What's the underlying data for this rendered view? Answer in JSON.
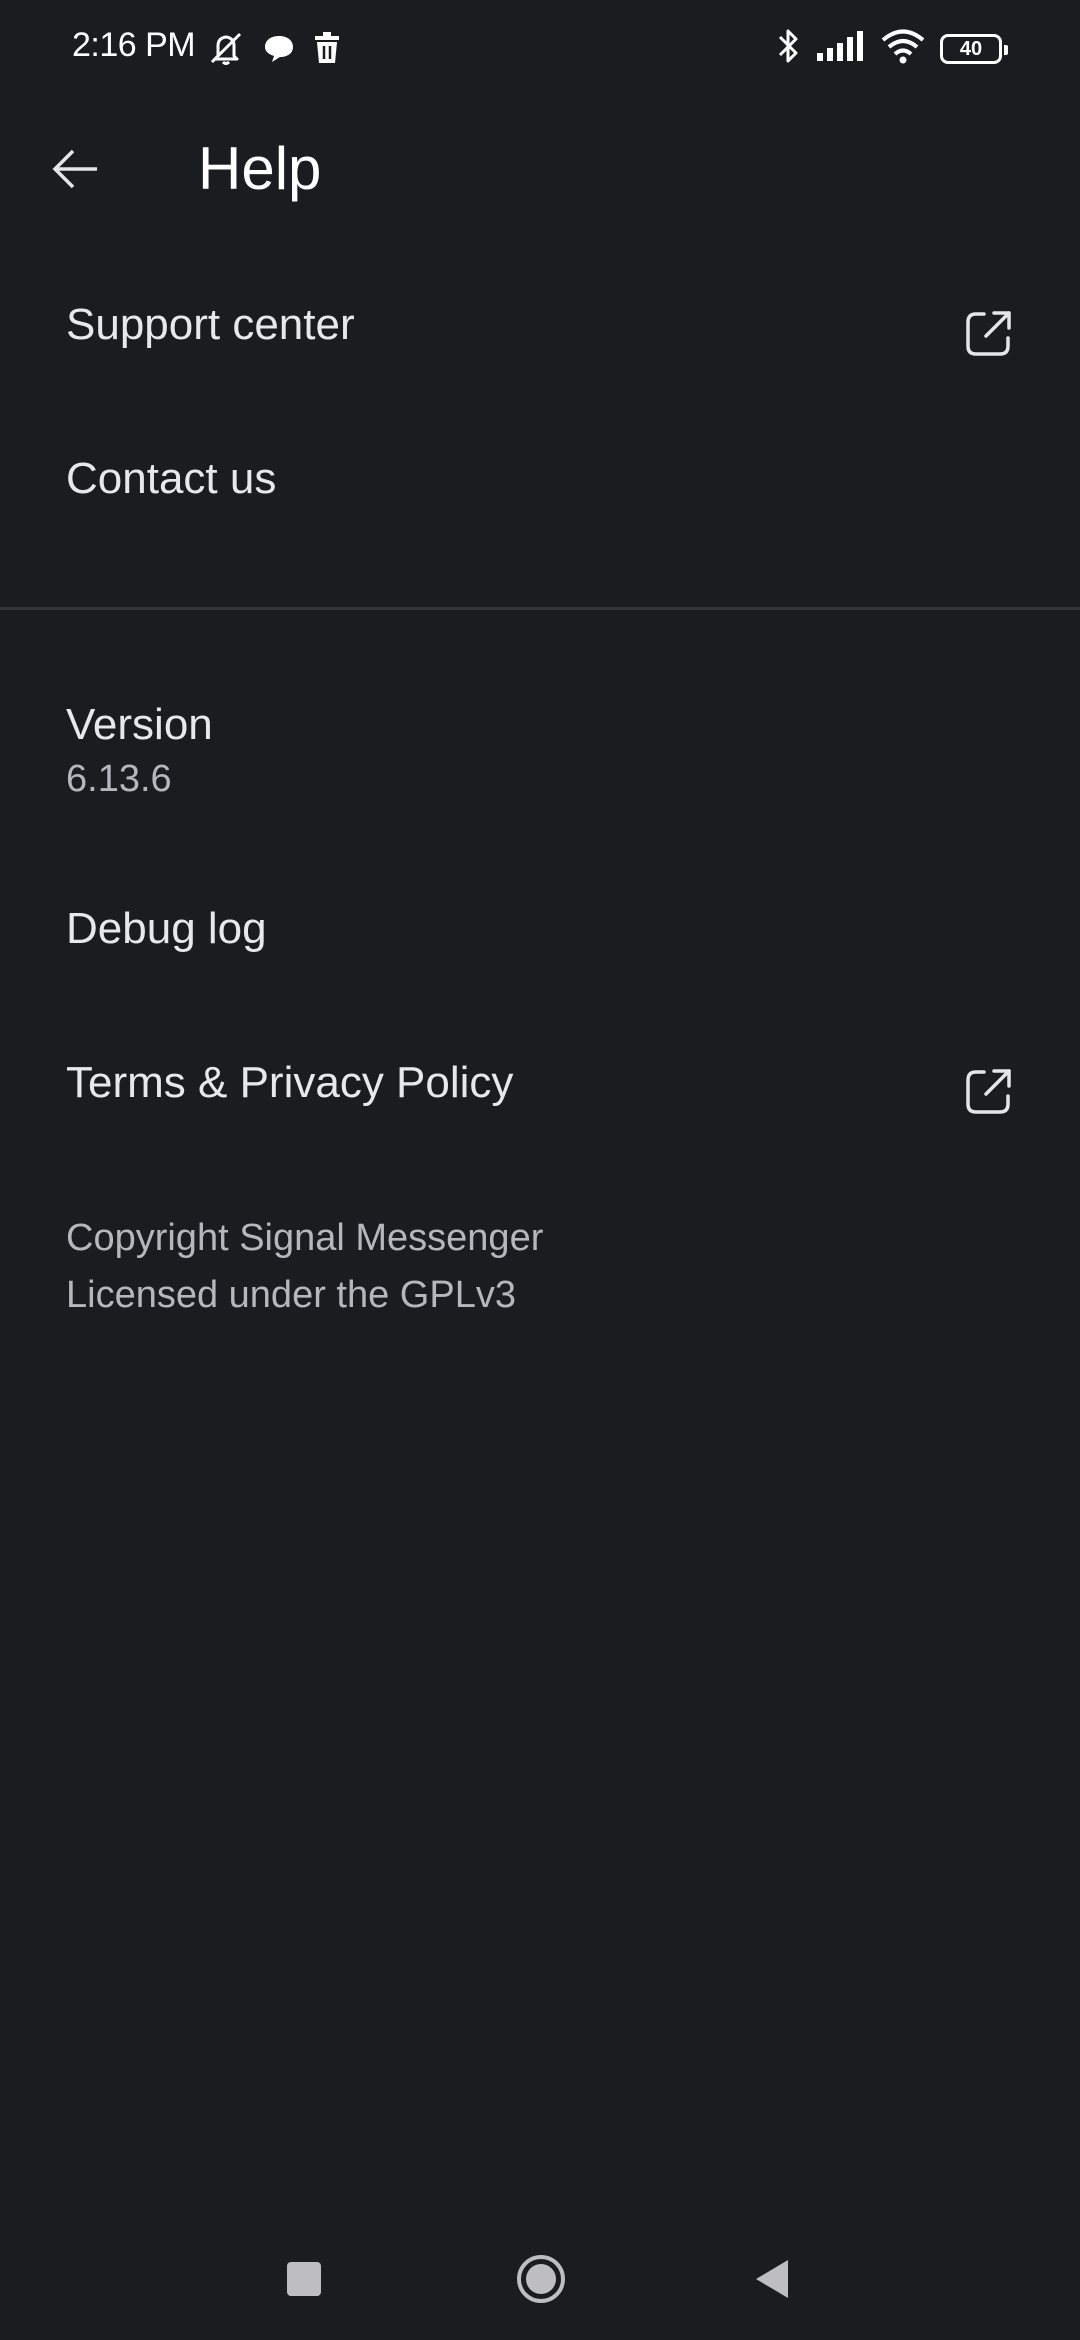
{
  "status_bar": {
    "time": "2:16 PM",
    "left_icons": [
      "mute-icon",
      "chat-bubble-icon",
      "trash-icon"
    ],
    "right_icons": [
      "bluetooth-icon",
      "signal-icon",
      "wifi-icon",
      "battery-icon"
    ],
    "battery_level": "40"
  },
  "app_bar": {
    "back_icon": "arrow-left-icon",
    "title": "Help"
  },
  "items": {
    "support_center": {
      "label": "Support center",
      "icon": "external-link-icon"
    },
    "contact_us": {
      "label": "Contact us"
    },
    "version": {
      "label": "Version",
      "value": "6.13.6"
    },
    "debug_log": {
      "label": "Debug log"
    },
    "terms": {
      "label": "Terms & Privacy Policy",
      "icon": "external-link-icon"
    }
  },
  "footer": {
    "line1": "Copyright Signal Messenger",
    "line2": "Licensed under the GPLv3"
  },
  "nav_bar": {
    "buttons": [
      "recents-button",
      "home-button",
      "back-button"
    ]
  },
  "colors": {
    "background": "#1b1c20",
    "primary_text": "#e8e8ec",
    "secondary_text": "#b6b6bc",
    "divider": "#34353a"
  }
}
